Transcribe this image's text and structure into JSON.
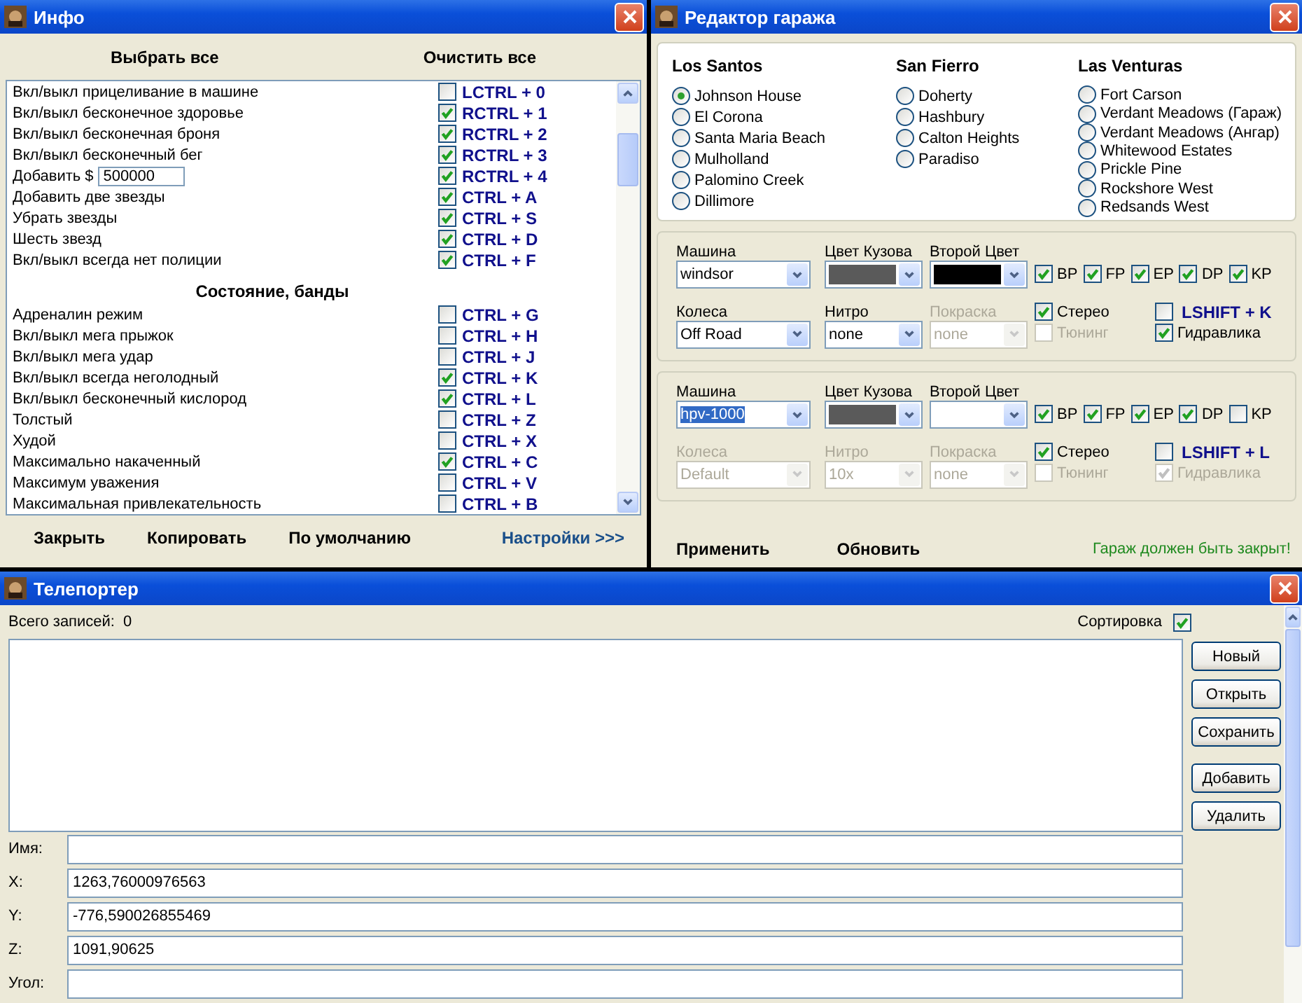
{
  "info": {
    "title": "Инфо",
    "select_all": "Выбрать все",
    "clear_all": "Очистить все",
    "rows": [
      {
        "kind": "toggle",
        "label": "Вкл/выкл прицеливание в машине",
        "checked": false,
        "hotkey": "LCTRL + 0"
      },
      {
        "kind": "toggle",
        "label": "Вкл/выкл бесконечное здоровье",
        "checked": true,
        "hotkey": "RCTRL + 1"
      },
      {
        "kind": "toggle",
        "label": "Вкл/выкл бесконечная броня",
        "checked": true,
        "hotkey": "RCTRL + 2"
      },
      {
        "kind": "toggle",
        "label": "Вкл/выкл бесконечный бег",
        "checked": true,
        "hotkey": "RCTRL + 3"
      },
      {
        "kind": "input",
        "label": "Добавить $",
        "value": "500000",
        "checked": true,
        "hotkey": "RCTRL + 4"
      },
      {
        "kind": "toggle",
        "label": "Добавить две звезды",
        "checked": true,
        "hotkey": "CTRL + A"
      },
      {
        "kind": "toggle",
        "label": "Убрать звезды",
        "checked": true,
        "hotkey": "CTRL + S"
      },
      {
        "kind": "toggle",
        "label": "Шесть звезд",
        "checked": true,
        "hotkey": "CTRL + D"
      },
      {
        "kind": "toggle",
        "label": "Вкл/выкл всегда нет полиции",
        "checked": true,
        "hotkey": "CTRL + F"
      },
      {
        "kind": "section",
        "label": "Состояние, банды"
      },
      {
        "kind": "toggle",
        "label": "Адреналин режим",
        "checked": false,
        "hotkey": "CTRL + G"
      },
      {
        "kind": "toggle",
        "label": "Вкл/выкл мега прыжок",
        "checked": false,
        "hotkey": "CTRL + H"
      },
      {
        "kind": "toggle",
        "label": "Вкл/выкл мега удар",
        "checked": false,
        "hotkey": "CTRL + J"
      },
      {
        "kind": "toggle",
        "label": "Вкл/выкл всегда неголодный",
        "checked": true,
        "hotkey": "CTRL + K"
      },
      {
        "kind": "toggle",
        "label": "Вкл/выкл бесконечный кислород",
        "checked": true,
        "hotkey": "CTRL + L"
      },
      {
        "kind": "toggle",
        "label": "Толстый",
        "checked": false,
        "hotkey": "CTRL + Z"
      },
      {
        "kind": "toggle",
        "label": "Худой",
        "checked": false,
        "hotkey": "CTRL + X"
      },
      {
        "kind": "toggle",
        "label": "Максимально накаченный",
        "checked": true,
        "hotkey": "CTRL + C"
      },
      {
        "kind": "toggle",
        "label": "Максимум уважения",
        "checked": false,
        "hotkey": "CTRL + V"
      },
      {
        "kind": "toggle",
        "label": "Максимальная привлекательность",
        "checked": false,
        "hotkey": "CTRL + B"
      }
    ],
    "buttons": [
      "Закрыть",
      "Копировать",
      "По умолчанию"
    ],
    "settings_link": "Настройки >>>"
  },
  "garage": {
    "title": "Редактор гаража",
    "districts": [
      {
        "name": "Los Santos",
        "garages": [
          {
            "label": "Johnson House",
            "selected": true
          },
          {
            "label": "El Corona",
            "selected": false
          },
          {
            "label": "Santa Maria Beach",
            "selected": false
          },
          {
            "label": "Mulholland",
            "selected": false
          },
          {
            "label": "Palomino Creek",
            "selected": false
          },
          {
            "label": "Dillimore",
            "selected": false
          }
        ]
      },
      {
        "name": "San Fierro",
        "garages": [
          {
            "label": "Doherty",
            "selected": false
          },
          {
            "label": "Hashbury",
            "selected": false
          },
          {
            "label": "Calton Heights",
            "selected": false
          },
          {
            "label": "Paradiso",
            "selected": false
          }
        ]
      },
      {
        "name": "Las Venturas",
        "garages": [
          {
            "label": "Fort Carson",
            "selected": false
          },
          {
            "label": "Verdant Meadows (Гараж)",
            "selected": false
          },
          {
            "label": "Verdant Meadows (Ангар)",
            "selected": false
          },
          {
            "label": "Whitewood Estates",
            "selected": false
          },
          {
            "label": "Prickle Pine",
            "selected": false
          },
          {
            "label": "Rockshore West",
            "selected": false
          },
          {
            "label": "Redsands West",
            "selected": false
          }
        ]
      }
    ],
    "cars": [
      {
        "fields": [
          {
            "kind": "combo",
            "label": "Машина",
            "value": "windsor",
            "disabled": false,
            "text_selected": false
          },
          {
            "kind": "swatch",
            "label": "Цвет Кузова",
            "color": "#5a5a5a",
            "disabled": false
          },
          {
            "kind": "swatch",
            "label": "Второй Цвет",
            "color": "#000000",
            "disabled": false
          },
          {
            "kind": "combo",
            "label": "Колеса",
            "value": "Off Road",
            "disabled": false,
            "text_selected": false
          },
          {
            "kind": "combo",
            "label": "Нитро",
            "value": "none",
            "disabled": false,
            "text_selected": false
          },
          {
            "kind": "combo",
            "label": "Покраска",
            "value": "none",
            "disabled": true,
            "text_selected": false
          }
        ],
        "flags": [
          {
            "label": "BP",
            "checked": true
          },
          {
            "label": "FP",
            "checked": true
          },
          {
            "label": "EP",
            "checked": true
          },
          {
            "label": "DP",
            "checked": true
          },
          {
            "label": "KP",
            "checked": true
          }
        ],
        "options": [
          {
            "kind": "plain",
            "label": "Стерео",
            "checked": true,
            "disabled": false
          },
          {
            "kind": "plain",
            "label": "Тюнинг",
            "checked": false,
            "disabled": true
          },
          {
            "kind": "hotkey",
            "label": "LSHIFT + K",
            "checked": false,
            "disabled": false
          },
          {
            "kind": "plain",
            "label": "Гидравлика",
            "checked": true,
            "disabled": false
          }
        ]
      },
      {
        "fields": [
          {
            "kind": "combo",
            "label": "Машина",
            "value": "hpv-1000",
            "disabled": false,
            "text_selected": true
          },
          {
            "kind": "swatch",
            "label": "Цвет Кузова",
            "color": "#5a5a5a",
            "disabled": false
          },
          {
            "kind": "swatch",
            "label": "Второй Цвет",
            "color": "#ffffff",
            "disabled": false
          },
          {
            "kind": "combo",
            "label": "Колеса",
            "value": "Default",
            "disabled": true,
            "text_selected": false
          },
          {
            "kind": "combo",
            "label": "Нитро",
            "value": "10x",
            "disabled": true,
            "text_selected": false
          },
          {
            "kind": "combo",
            "label": "Покраска",
            "value": "none",
            "disabled": true,
            "text_selected": false
          }
        ],
        "flags": [
          {
            "label": "BP",
            "checked": true
          },
          {
            "label": "FP",
            "checked": true
          },
          {
            "label": "EP",
            "checked": true
          },
          {
            "label": "DP",
            "checked": true
          },
          {
            "label": "KP",
            "checked": false
          }
        ],
        "options": [
          {
            "kind": "plain",
            "label": "Стерео",
            "checked": true,
            "disabled": false
          },
          {
            "kind": "plain",
            "label": "Тюнинг",
            "checked": false,
            "disabled": true
          },
          {
            "kind": "hotkey",
            "label": "LSHIFT + L",
            "checked": false,
            "disabled": false
          },
          {
            "kind": "plain",
            "label": "Гидравлика",
            "checked": true,
            "disabled": true
          }
        ]
      }
    ],
    "buttons": [
      "Применить",
      "Обновить"
    ],
    "warning": "Гараж должен быть закрыт!"
  },
  "teleporter": {
    "title": "Телепортер",
    "count_label": "Всего записей:",
    "count": "0",
    "sort": {
      "label": "Сортировка",
      "checked": true
    },
    "buttons": [
      "Новый",
      "Открыть",
      "Сохранить",
      "Добавить",
      "Удалить"
    ],
    "fields": [
      {
        "label": "Имя:"
      },
      {
        "label": "X:",
        "value": "1263,76000976563"
      },
      {
        "label": "Y:",
        "value": "-776,590026855469"
      },
      {
        "label": "Z:",
        "value": "1091,90625"
      },
      {
        "label": "Угол:"
      }
    ]
  }
}
